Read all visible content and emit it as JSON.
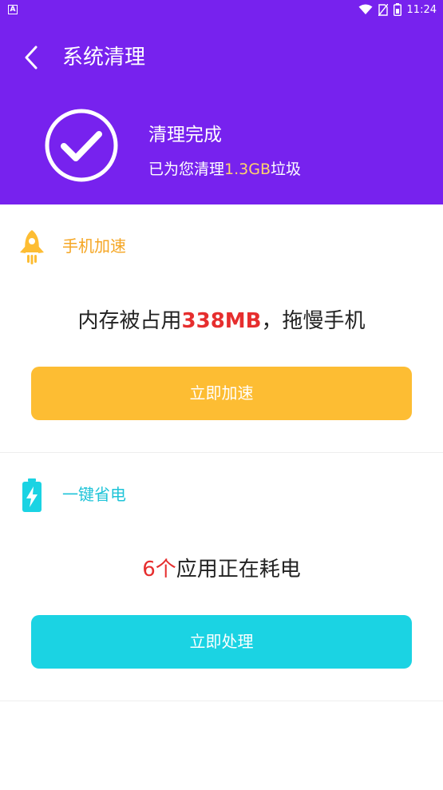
{
  "status_bar": {
    "notification_icon": "A",
    "icons": [
      "wifi-icon",
      "no-sim-icon",
      "battery-icon"
    ],
    "time": "11:24"
  },
  "header": {
    "back_icon": "chevron-left-icon",
    "title": "系统清理",
    "result_icon": "check-circle-icon",
    "done_title": "清理完成",
    "done_sub_prefix": "已为您清理",
    "done_sub_amount": "1.3GB",
    "done_sub_suffix": "垃圾"
  },
  "boost": {
    "icon": "rocket-icon",
    "title": "手机加速",
    "msg_prefix": "内存被占用",
    "msg_value": "338MB",
    "msg_suffix": "，拖慢手机",
    "button_label": "立即加速"
  },
  "power": {
    "icon": "battery-charging-icon",
    "title": "一键省电",
    "msg_value": "6个",
    "msg_suffix": "应用正在耗电",
    "button_label": "立即处理"
  },
  "colors": {
    "header_bg": "#7722ee",
    "boost_accent": "#fdbd33",
    "power_accent": "#1bd3e3",
    "highlight": "#e62e2e"
  }
}
